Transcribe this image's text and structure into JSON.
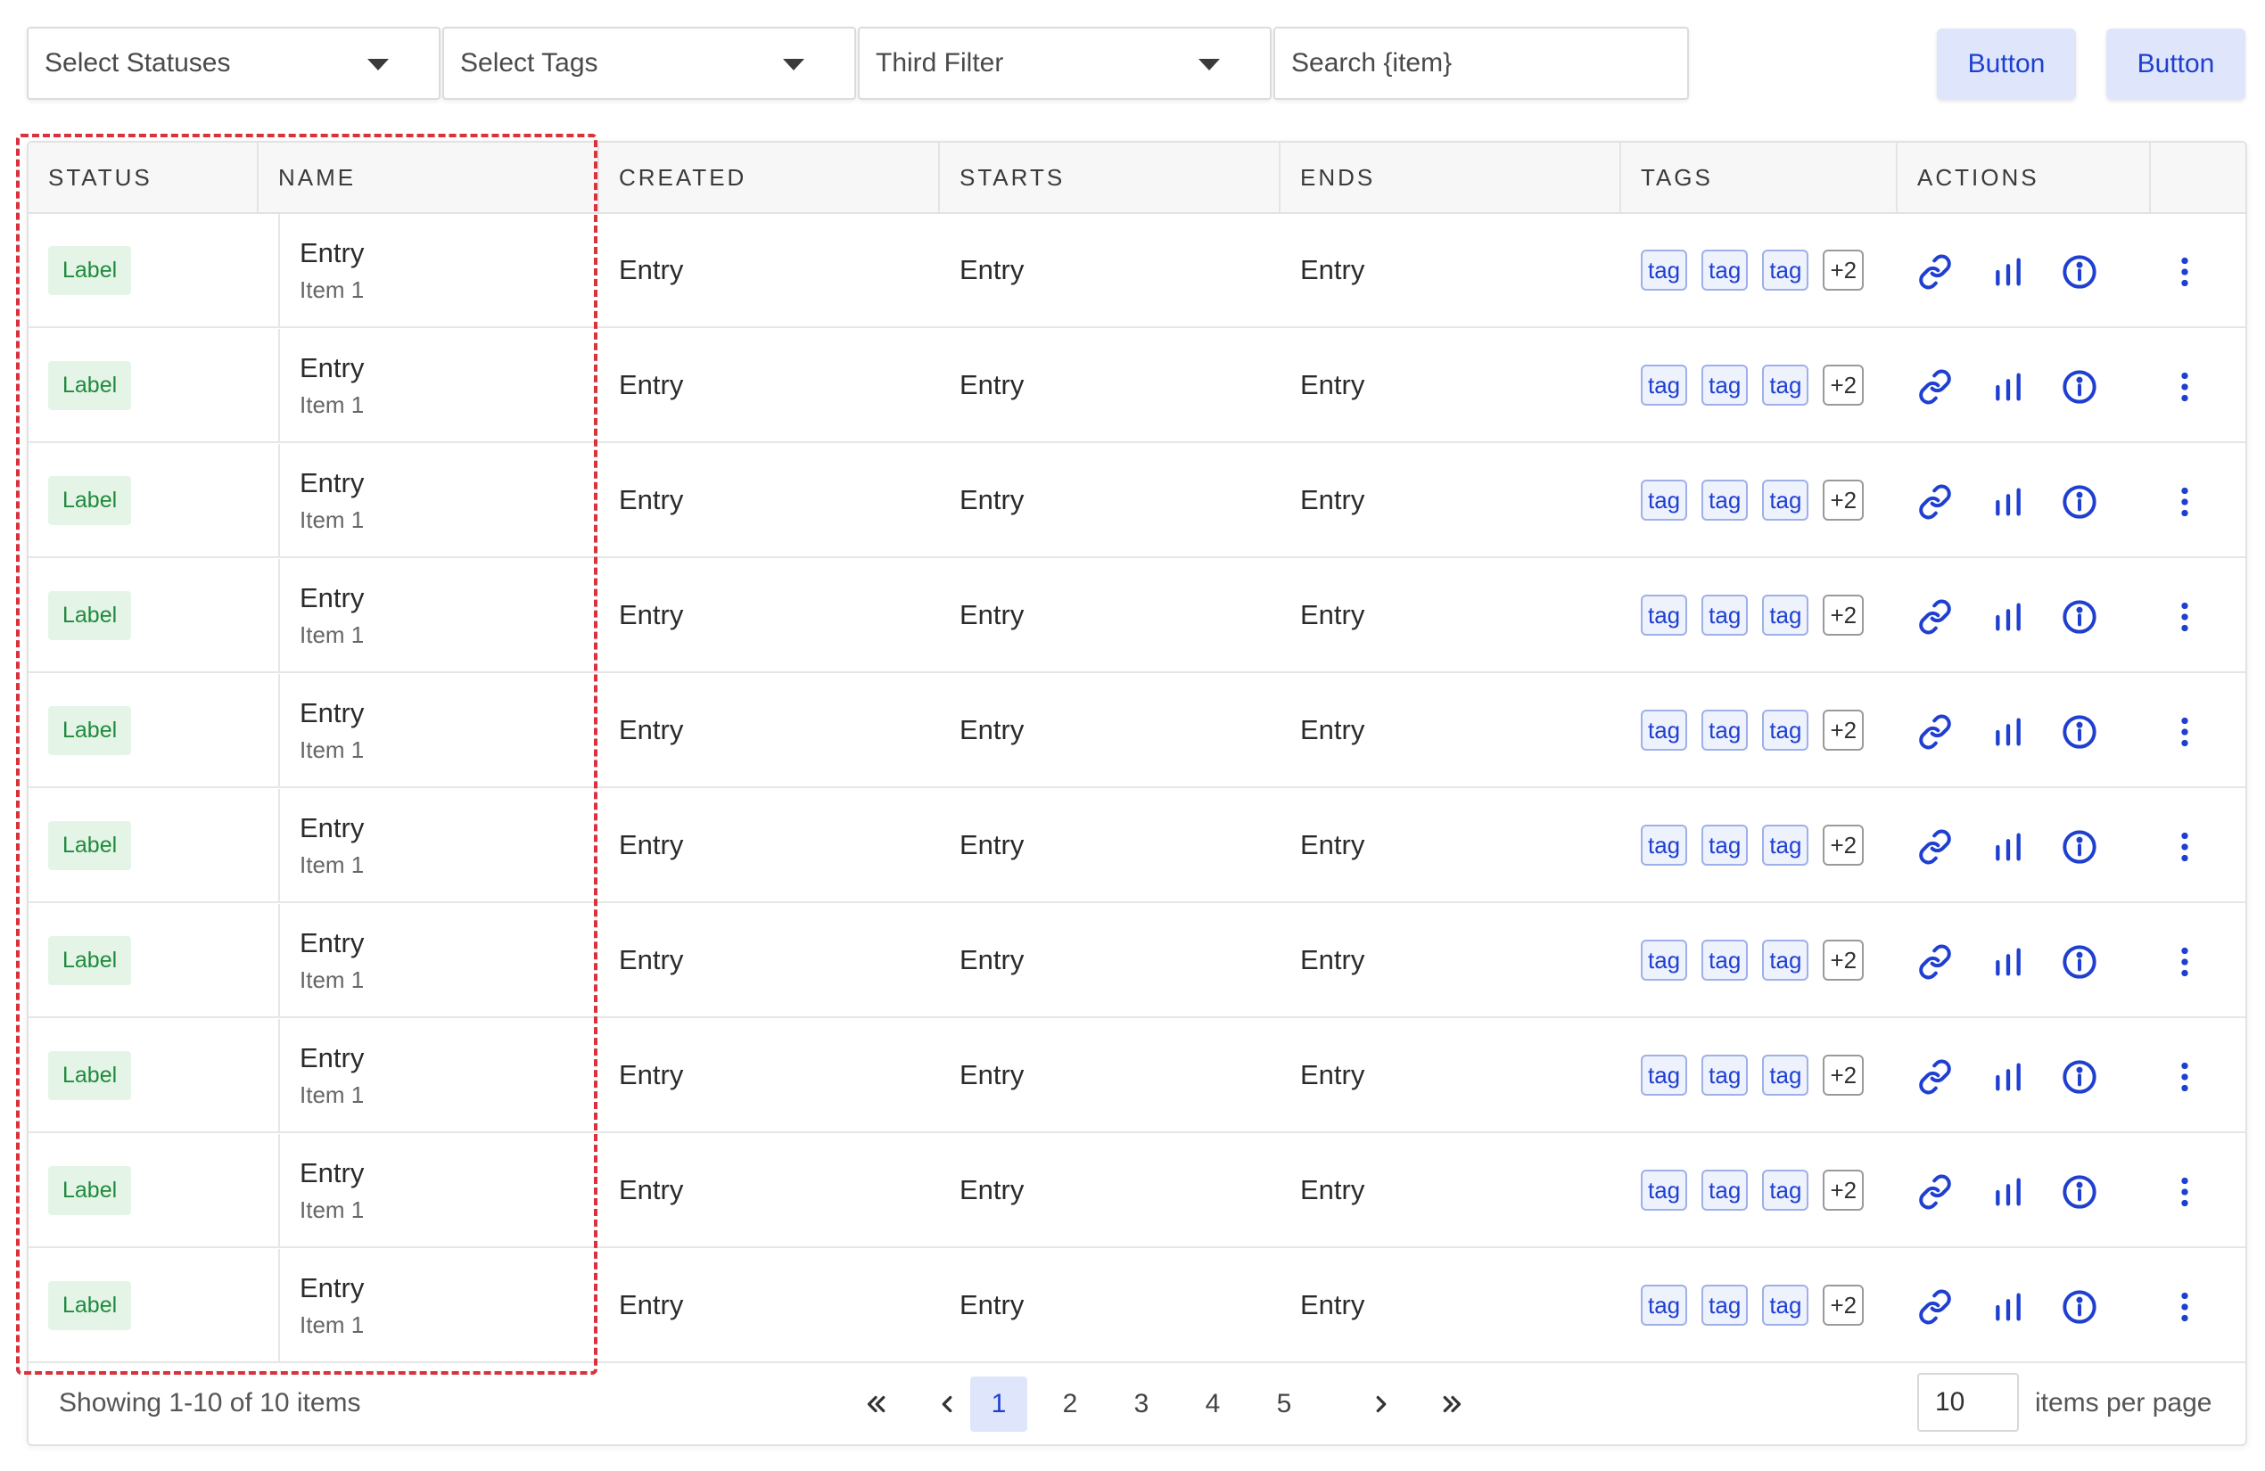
{
  "filters": {
    "statuses_placeholder": "Select Statuses",
    "tags_placeholder": "Select Tags",
    "third_placeholder": "Third Filter",
    "search_placeholder": "Search {item}"
  },
  "toolbar": {
    "button1_label": "Button",
    "button2_label": "Button"
  },
  "table": {
    "headers": {
      "status": "STATUS",
      "name": "NAME",
      "created": "CREATED",
      "starts": "STARTS",
      "ends": "ENDS",
      "tags": "TAGS",
      "actions": "ACTIONS"
    },
    "rows": [
      {
        "status": "Label",
        "name": "Entry",
        "sub": "Item 1",
        "created": "Entry",
        "starts": "Entry",
        "ends": "Entry",
        "tags": [
          "tag",
          "tag",
          "tag"
        ],
        "more": "+2"
      },
      {
        "status": "Label",
        "name": "Entry",
        "sub": "Item 1",
        "created": "Entry",
        "starts": "Entry",
        "ends": "Entry",
        "tags": [
          "tag",
          "tag",
          "tag"
        ],
        "more": "+2"
      },
      {
        "status": "Label",
        "name": "Entry",
        "sub": "Item 1",
        "created": "Entry",
        "starts": "Entry",
        "ends": "Entry",
        "tags": [
          "tag",
          "tag",
          "tag"
        ],
        "more": "+2"
      },
      {
        "status": "Label",
        "name": "Entry",
        "sub": "Item 1",
        "created": "Entry",
        "starts": "Entry",
        "ends": "Entry",
        "tags": [
          "tag",
          "tag",
          "tag"
        ],
        "more": "+2"
      },
      {
        "status": "Label",
        "name": "Entry",
        "sub": "Item 1",
        "created": "Entry",
        "starts": "Entry",
        "ends": "Entry",
        "tags": [
          "tag",
          "tag",
          "tag"
        ],
        "more": "+2"
      },
      {
        "status": "Label",
        "name": "Entry",
        "sub": "Item 1",
        "created": "Entry",
        "starts": "Entry",
        "ends": "Entry",
        "tags": [
          "tag",
          "tag",
          "tag"
        ],
        "more": "+2"
      },
      {
        "status": "Label",
        "name": "Entry",
        "sub": "Item 1",
        "created": "Entry",
        "starts": "Entry",
        "ends": "Entry",
        "tags": [
          "tag",
          "tag",
          "tag"
        ],
        "more": "+2"
      },
      {
        "status": "Label",
        "name": "Entry",
        "sub": "Item 1",
        "created": "Entry",
        "starts": "Entry",
        "ends": "Entry",
        "tags": [
          "tag",
          "tag",
          "tag"
        ],
        "more": "+2"
      },
      {
        "status": "Label",
        "name": "Entry",
        "sub": "Item 1",
        "created": "Entry",
        "starts": "Entry",
        "ends": "Entry",
        "tags": [
          "tag",
          "tag",
          "tag"
        ],
        "more": "+2"
      },
      {
        "status": "Label",
        "name": "Entry",
        "sub": "Item 1",
        "created": "Entry",
        "starts": "Entry",
        "ends": "Entry",
        "tags": [
          "tag",
          "tag",
          "tag"
        ],
        "more": "+2"
      }
    ],
    "action_icons": [
      "link-icon",
      "bar-chart-icon",
      "info-icon",
      "more-vertical-icon"
    ]
  },
  "pagination": {
    "showing_text": "Showing 1-10 of 10 items",
    "pages": [
      "1",
      "2",
      "3",
      "4",
      "5"
    ],
    "current_page": "1",
    "per_page_value": "10",
    "per_page_label": "items per page"
  },
  "colors": {
    "accent": "#1f3fd0",
    "button_bg": "#dfe6fc",
    "status_label_bg": "#e4f5e8",
    "status_label_text": "#1f8a3b",
    "highlight_outline": "#d8323c"
  }
}
